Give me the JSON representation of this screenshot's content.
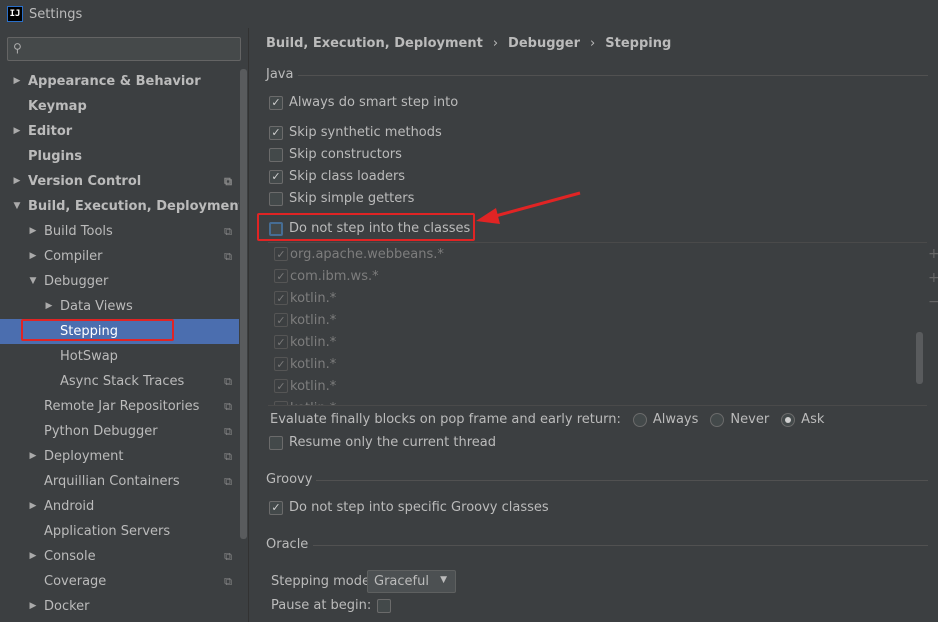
{
  "window": {
    "title": "Settings",
    "app_icon_text": "IJ"
  },
  "search": {
    "placeholder": ""
  },
  "sidebar": {
    "items": [
      {
        "label": "Appearance & Behavior",
        "level": 0,
        "arrow": "right",
        "bold": true
      },
      {
        "label": "Keymap",
        "level": 0,
        "arrow": "",
        "bold": true
      },
      {
        "label": "Editor",
        "level": 0,
        "arrow": "right",
        "bold": true
      },
      {
        "label": "Plugins",
        "level": 0,
        "arrow": "",
        "bold": true
      },
      {
        "label": "Version Control",
        "level": 0,
        "arrow": "right",
        "bold": true,
        "cfg": true
      },
      {
        "label": "Build, Execution, Deployment",
        "level": 0,
        "arrow": "down",
        "bold": true
      },
      {
        "label": "Build Tools",
        "level": 1,
        "arrow": "right",
        "cfg": true
      },
      {
        "label": "Compiler",
        "level": 1,
        "arrow": "right",
        "cfg": true
      },
      {
        "label": "Debugger",
        "level": 1,
        "arrow": "down"
      },
      {
        "label": "Data Views",
        "level": 2,
        "arrow": "right"
      },
      {
        "label": "Stepping",
        "level": 2,
        "arrow": "",
        "selected": true
      },
      {
        "label": "HotSwap",
        "level": 2,
        "arrow": ""
      },
      {
        "label": "Async Stack Traces",
        "level": 2,
        "arrow": "",
        "cfg": true
      },
      {
        "label": "Remote Jar Repositories",
        "level": 1,
        "arrow": "",
        "cfg": true
      },
      {
        "label": "Python Debugger",
        "level": 1,
        "arrow": "",
        "cfg": true
      },
      {
        "label": "Deployment",
        "level": 1,
        "arrow": "right",
        "cfg": true
      },
      {
        "label": "Arquillian Containers",
        "level": 1,
        "arrow": "",
        "cfg": true
      },
      {
        "label": "Android",
        "level": 1,
        "arrow": "right"
      },
      {
        "label": "Application Servers",
        "level": 1,
        "arrow": ""
      },
      {
        "label": "Console",
        "level": 1,
        "arrow": "right",
        "cfg": true
      },
      {
        "label": "Coverage",
        "level": 1,
        "arrow": "",
        "cfg": true
      },
      {
        "label": "Docker",
        "level": 1,
        "arrow": "right"
      }
    ]
  },
  "breadcrumb": {
    "part1": "Build, Execution, Deployment",
    "sep": "›",
    "part2": "Debugger",
    "part3": "Stepping"
  },
  "java": {
    "title": "Java",
    "options": [
      {
        "label": "Always do smart step into",
        "checked": true
      },
      {
        "label": "Skip synthetic methods",
        "checked": true
      },
      {
        "label": "Skip constructors",
        "checked": false
      },
      {
        "label": "Skip class loaders",
        "checked": true
      },
      {
        "label": "Skip simple getters",
        "checked": false
      },
      {
        "label": "Do not step into the classes",
        "checked": false
      }
    ],
    "classes": [
      "org.apache.webbeans.*",
      "com.ibm.ws.*",
      "kotlin.*",
      "kotlin.*",
      "kotlin.*",
      "kotlin.*",
      "kotlin.*",
      "kotlin.*"
    ],
    "evaluate_label": "Evaluate finally blocks on pop frame and early return:",
    "radio": [
      {
        "label": "Always",
        "selected": false
      },
      {
        "label": "Never",
        "selected": false
      },
      {
        "label": "Ask",
        "selected": true
      }
    ],
    "resume_label": "Resume only the current thread"
  },
  "groovy": {
    "title": "Groovy",
    "option": "Do not step into specific Groovy classes"
  },
  "oracle": {
    "title": "Oracle",
    "stepping_mode_label": "Stepping mode:",
    "stepping_mode_value": "Graceful",
    "pause_label": "Pause at begin:"
  },
  "icons": {
    "check": "✓",
    "search": "search-icon",
    "config": "config-icon"
  },
  "colors": {
    "background": "#3c3f41",
    "selection": "#4b6eaf",
    "annotation_red": "#e02424"
  }
}
